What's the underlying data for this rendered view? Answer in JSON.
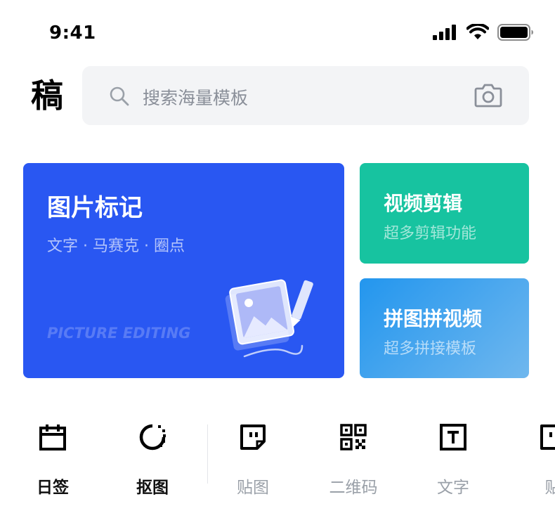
{
  "status_bar": {
    "time": "9:41"
  },
  "app": {
    "logo": "稿"
  },
  "search": {
    "placeholder": "搜索海量模板"
  },
  "cards": {
    "main": {
      "title": "图片标记",
      "subtitle": "文字 · 马赛克 · 圈点",
      "en_title": "PICTURE EDITING"
    },
    "video": {
      "title": "视频剪辑",
      "subtitle": "超多剪辑功能"
    },
    "puzzle": {
      "title": "拼图拼视频",
      "subtitle": "超多拼接模板"
    }
  },
  "tools": [
    {
      "label": "日签",
      "icon": "calendar-icon",
      "active": true
    },
    {
      "label": "抠图",
      "icon": "cutout-icon",
      "active": true
    },
    {
      "label": "贴图",
      "icon": "sticker-icon",
      "active": false
    },
    {
      "label": "二维码",
      "icon": "qrcode-icon",
      "active": false
    },
    {
      "label": "文字",
      "icon": "text-icon",
      "active": false
    },
    {
      "label": "贴",
      "icon": "sticker-icon",
      "active": false
    }
  ],
  "colors": {
    "main_card": "#2957f2",
    "video_card": "#17c3a0",
    "puzzle_card": "#2396ee",
    "search_bg": "#f3f4f6"
  }
}
